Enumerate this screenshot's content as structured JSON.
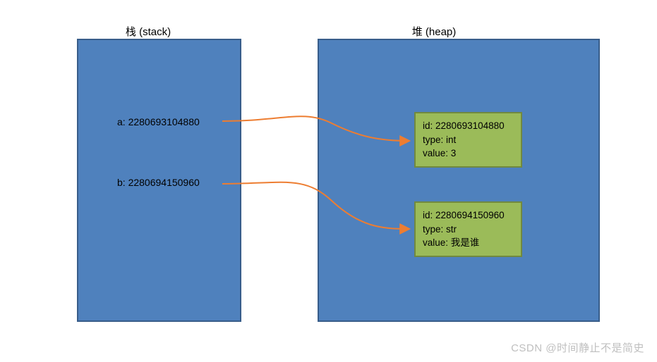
{
  "labels": {
    "stack": "栈 (stack)",
    "heap": "堆 (heap)"
  },
  "stack": {
    "a": {
      "name": "a",
      "ref": "2280693104880",
      "display": "a: 2280693104880"
    },
    "b": {
      "name": "b",
      "ref": "2280694150960",
      "display": "b: 2280694150960"
    }
  },
  "heap": {
    "obj1": {
      "id_label": "id:",
      "id": "2280693104880",
      "type_label": "type:",
      "type": "int",
      "value_label": "value:",
      "value": "3"
    },
    "obj2": {
      "id_label": "id:",
      "id": "2280694150960",
      "type_label": "type:",
      "type": "str",
      "value_label": "value:",
      "value": "我是谁"
    }
  },
  "watermark": "CSDN @时间静止不是简史",
  "colors": {
    "box_fill": "#4f81bd",
    "box_stroke": "#385d8a",
    "obj_fill": "#9bbb59",
    "obj_stroke": "#71893f",
    "arrow": "#ed7d31"
  },
  "chart_data": {
    "type": "diagram",
    "description": "Python stack/heap memory model: variable names on the stack hold object ids pointing into heap-allocated objects with id/type/value.",
    "stack_entries": [
      {
        "name": "a",
        "id": 2280693104880
      },
      {
        "name": "b",
        "id": 2280694150960
      }
    ],
    "heap_objects": [
      {
        "id": 2280693104880,
        "type": "int",
        "value": 3
      },
      {
        "id": 2280694150960,
        "type": "str",
        "value": "我是谁"
      }
    ],
    "pointers": [
      {
        "from_stack": "a",
        "to_heap_id": 2280693104880
      },
      {
        "from_stack": "b",
        "to_heap_id": 2280694150960
      }
    ]
  }
}
